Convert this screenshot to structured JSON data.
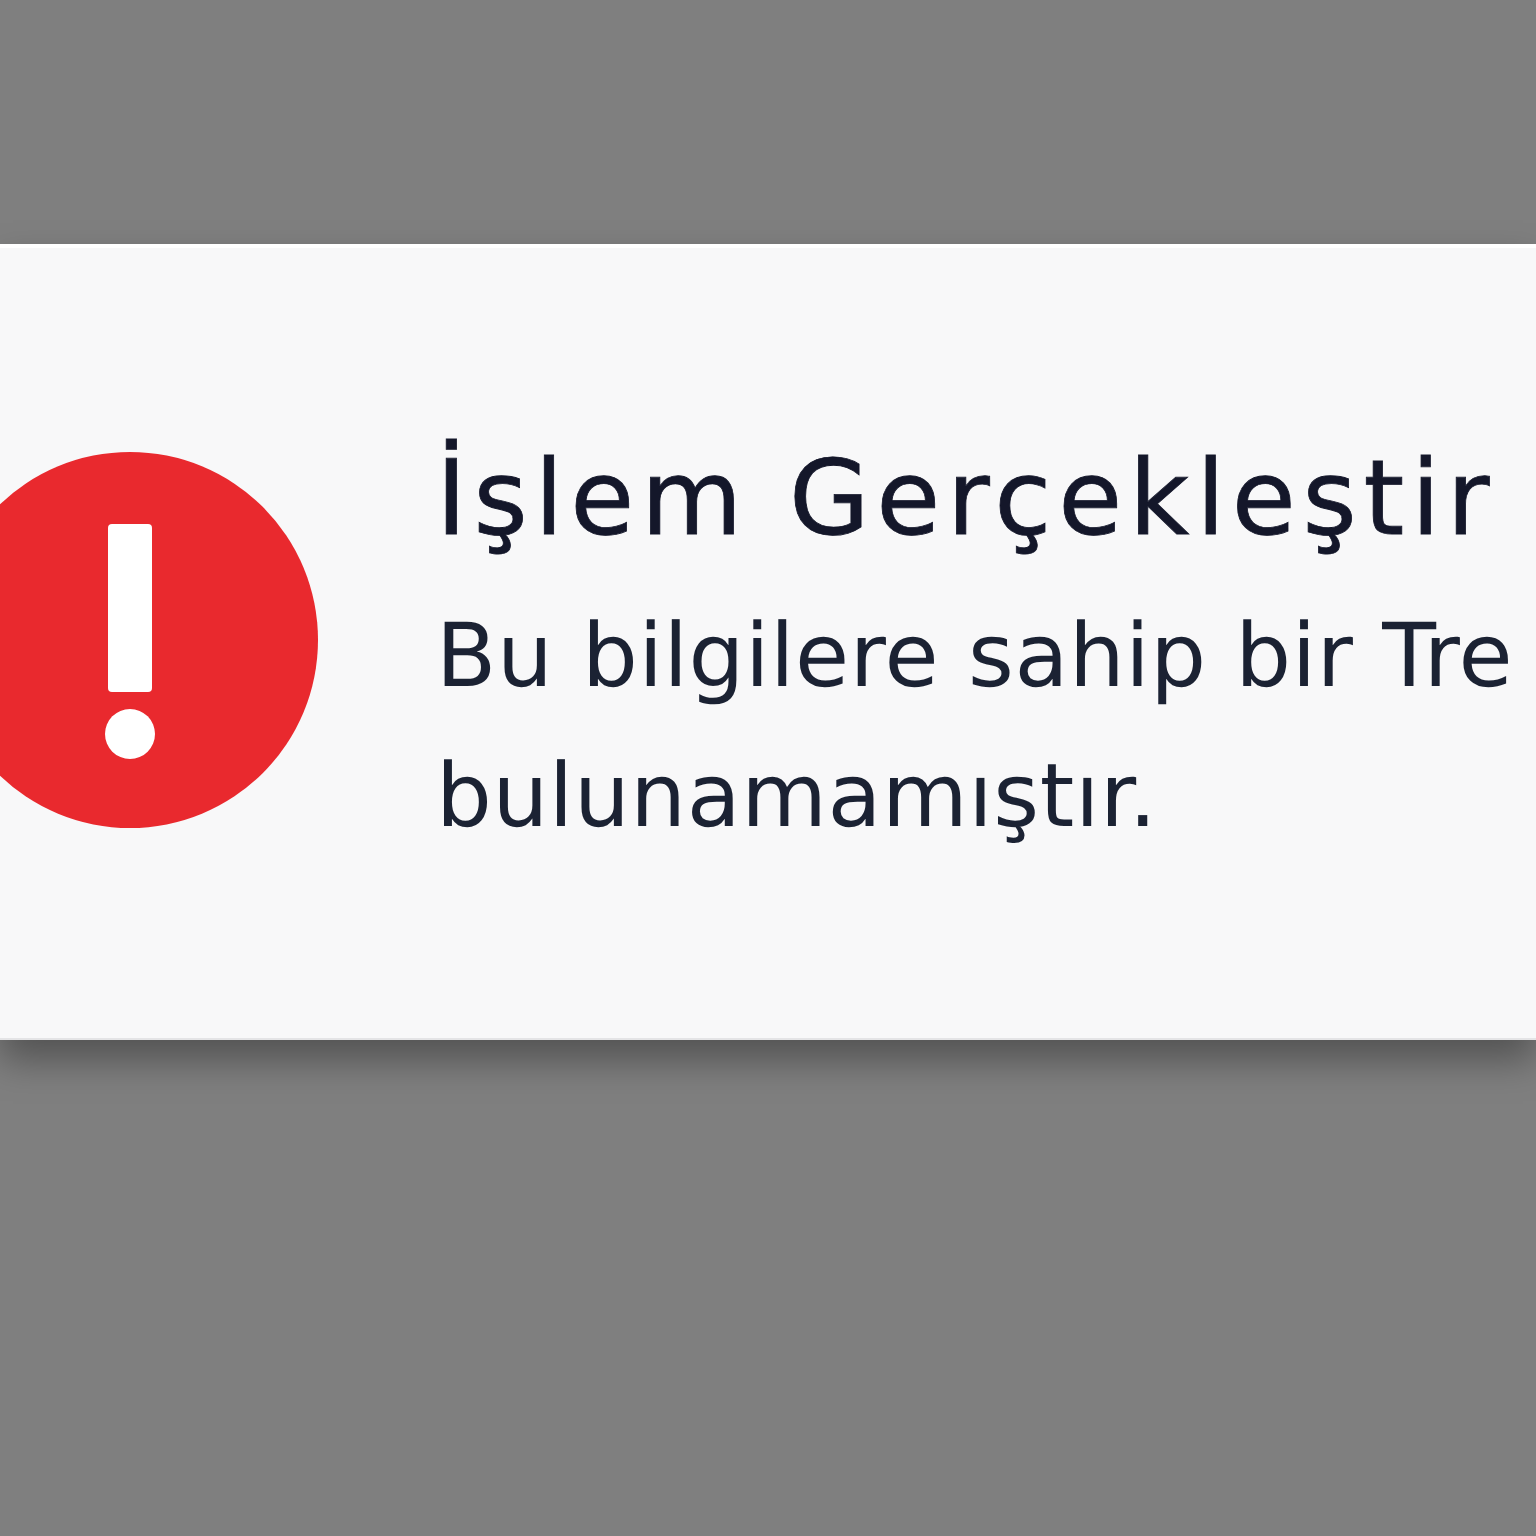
{
  "alert": {
    "kind": "error",
    "title": "İşlem Gerçekleştir",
    "message_lines": [
      "Bu bilgilere sahip bir Tre",
      "bulunamamıştır."
    ]
  }
}
